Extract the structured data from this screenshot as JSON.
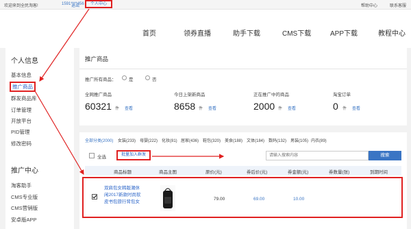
{
  "topbar": {
    "welcome": "欢迎来到全民淘客!",
    "phone": "1591****456",
    "logout": "退出",
    "personal_center": "个人中心",
    "help_center": "帮助中心",
    "contact_service": "联系客服"
  },
  "nav": {
    "items": [
      "首页",
      "领券直播",
      "助手下载",
      "CMS下载",
      "APP下载",
      "教程中心"
    ]
  },
  "sidebar": {
    "personal_title": "个人信息",
    "personal_items": [
      "基本信息",
      "推广商品",
      "群发商品库",
      "订单管理",
      "开放平台",
      "PID管理",
      "修改密码"
    ],
    "promo_title": "推广中心",
    "promo_items": [
      "淘客助手",
      "CMS专业版",
      "CMS营销版",
      "安卓版APP"
    ]
  },
  "main": {
    "title": "推广商品",
    "all_promoted_label": "推广所有商品：",
    "radio_yes": "是",
    "radio_no": "否",
    "stats": [
      {
        "label": "全网推广商品",
        "value": "60321",
        "unit": "件",
        "link": "查看"
      },
      {
        "label": "今日上架新商品",
        "value": "8658",
        "unit": "件",
        "link": "查看"
      },
      {
        "label": "正在推广中的商品",
        "value": "2000",
        "unit": "件",
        "link": "查看"
      },
      {
        "label": "淘宝订单",
        "value": "0",
        "unit": "件",
        "link": "查看"
      }
    ],
    "categories": [
      "全部分类(2000)",
      "女装(233)",
      "母婴(222)",
      "化妆(81)",
      "居家(436)",
      "鞋包(320)",
      "美食(188)",
      "文体(184)",
      "数码(132)",
      "男装(105)",
      "内衣(89)"
    ],
    "select_all": "全选",
    "batch_add": "批量加入群发",
    "search_placeholder": "请输入搜索内容",
    "search_button": "搜索",
    "table_headers": [
      "商品标题",
      "商品主图",
      "原价(元)",
      "券后价(元)",
      "券金额(元)",
      "券数量(张)",
      "到期时间"
    ],
    "rows": [
      {
        "title": "双肩包女韩版潮休闲2017新款时尚软皮书包旅行背包女",
        "price": "79.00",
        "after_coupon": "69.00",
        "coupon_amount": "10.00",
        "coupon_count": "",
        "expire": ""
      }
    ]
  },
  "colors": {
    "accent": "#3a75c4",
    "annotation": "#e02020"
  }
}
